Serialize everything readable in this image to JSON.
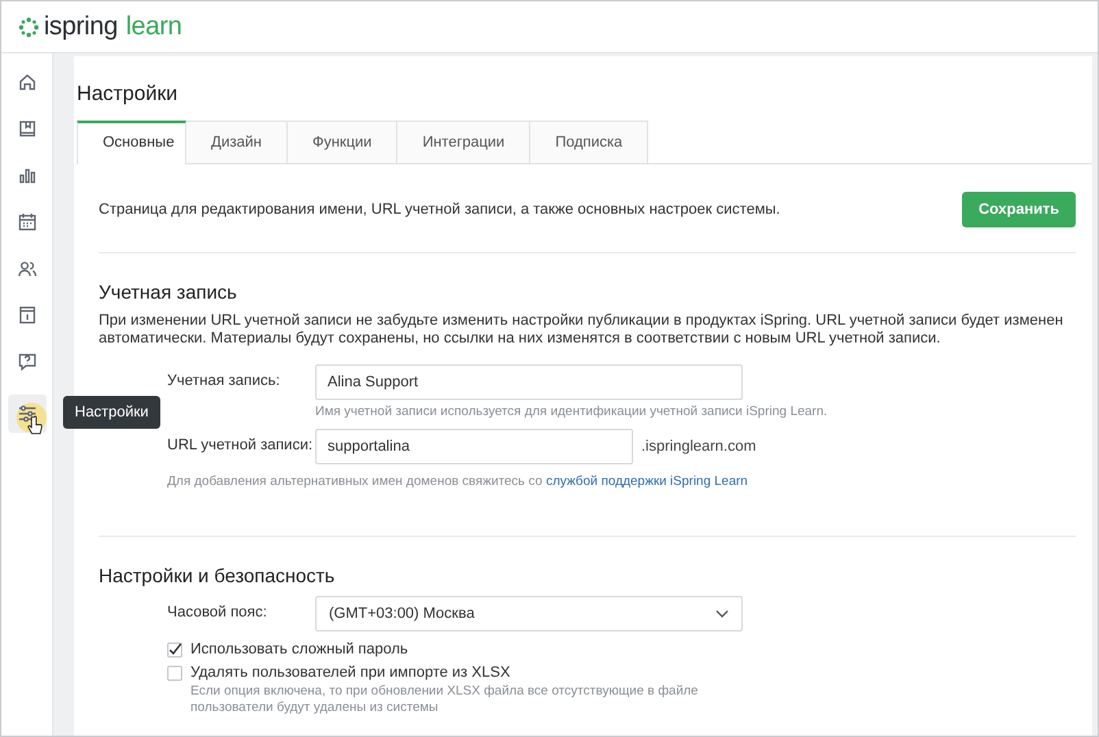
{
  "logo": {
    "brand": "ispring",
    "product": "learn"
  },
  "sidebar": {
    "items": [
      {
        "kind": "home",
        "selected": false
      },
      {
        "kind": "book",
        "selected": false
      },
      {
        "kind": "chart",
        "selected": false
      },
      {
        "kind": "calendar",
        "selected": false
      },
      {
        "kind": "people",
        "selected": false
      },
      {
        "kind": "info",
        "selected": false
      },
      {
        "kind": "question",
        "selected": false
      },
      {
        "kind": "settings",
        "selected": true
      }
    ],
    "tooltip": "Настройки"
  },
  "page": {
    "title": "Настройки"
  },
  "tabs": [
    {
      "label": "Основные",
      "selected": true
    },
    {
      "label": "Дизайн",
      "selected": false
    },
    {
      "label": "Функции",
      "selected": false
    },
    {
      "label": "Интеграции",
      "selected": false
    },
    {
      "label": "Подписка",
      "selected": false
    }
  ],
  "intro": "Страница для редактирования имени, URL учетной записи, а также основных настроек системы.",
  "save_button": "Сохранить",
  "account": {
    "heading": "Учетная запись",
    "note": "При изменении URL учетной записи не забудьте изменить настройки публикации в продуктах iSpring. URL учетной записи будет изменен автоматически. Материалы будут сохранены, но ссылки на них изменятся в соответствии с новым URL учетной записи.",
    "fields": [
      {
        "label": "Учетная запись:",
        "value": "Alina Support",
        "hint": "Имя учетной записи используется для идентификации учетной записи iSpring Learn."
      },
      {
        "label": "URL учетной записи:",
        "value": "supportalina",
        "suffix": ".ispringlearn.com"
      }
    ],
    "domain_hint": {
      "text": "Для добавления альтернативных имен доменов свяжитесь со",
      "link": "службой поддержки iSpring Learn"
    }
  },
  "security": {
    "heading": "Настройки и безопасность",
    "timezone": {
      "label": "Часовой пояс:",
      "value": "(GMT+03:00) Москва"
    },
    "options": [
      {
        "label": "Использовать сложный пароль",
        "checked": true
      },
      {
        "label": "Удалять пользователей при импорте из XLSX",
        "checked": false,
        "description": "Если опция включена, то при обновлении XLSX файла все отсутствующие в файле пользователи будут удалены из системы"
      }
    ]
  }
}
